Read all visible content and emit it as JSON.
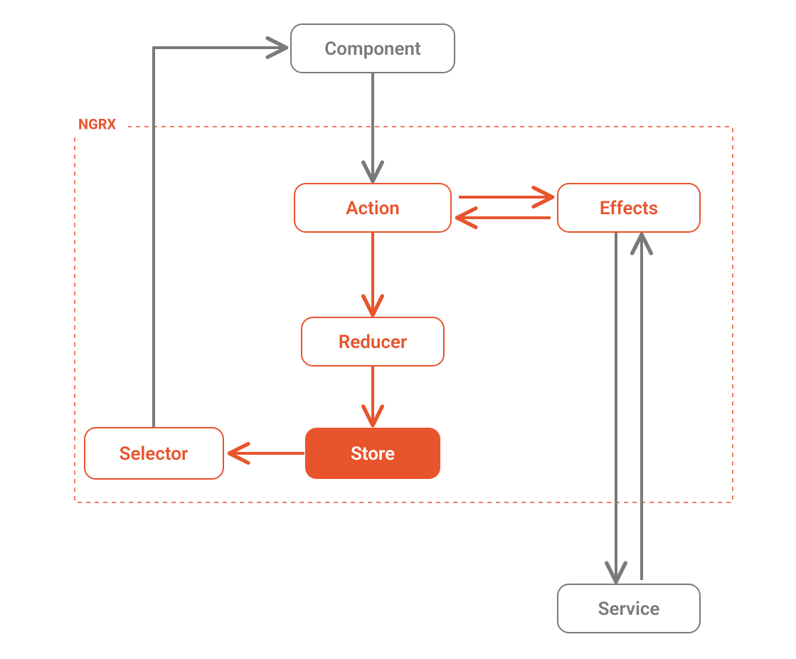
{
  "diagram": {
    "group_label": "NGRX",
    "nodes": {
      "component": {
        "label": "Component"
      },
      "action": {
        "label": "Action"
      },
      "effects": {
        "label": "Effects"
      },
      "reducer": {
        "label": "Reducer"
      },
      "store": {
        "label": "Store"
      },
      "selector": {
        "label": "Selector"
      },
      "service": {
        "label": "Service"
      }
    },
    "colors": {
      "orange": "#E8542C",
      "gray": "#7A7A7A",
      "white": "#FFFFFF"
    },
    "edges": [
      {
        "from": "component",
        "to": "action",
        "color": "gray"
      },
      {
        "from": "action",
        "to": "effects",
        "color": "orange"
      },
      {
        "from": "effects",
        "to": "action",
        "color": "orange"
      },
      {
        "from": "action",
        "to": "reducer",
        "color": "orange"
      },
      {
        "from": "reducer",
        "to": "store",
        "color": "orange"
      },
      {
        "from": "store",
        "to": "selector",
        "color": "orange"
      },
      {
        "from": "selector",
        "to": "component",
        "color": "gray"
      },
      {
        "from": "effects",
        "to": "service",
        "color": "gray"
      },
      {
        "from": "service",
        "to": "effects",
        "color": "gray"
      }
    ]
  }
}
